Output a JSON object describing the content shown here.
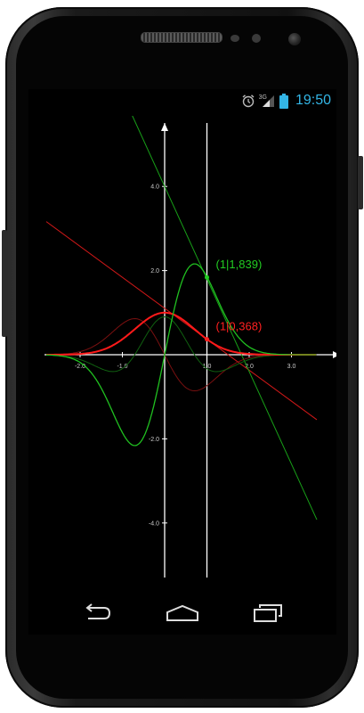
{
  "status_bar": {
    "time": "19:50",
    "network": "3G",
    "icons": [
      "alarm-icon",
      "signal-icon",
      "battery-icon"
    ],
    "accent_color": "#33b5e5"
  },
  "chart_data": {
    "type": "line",
    "xlim": [
      -2.8,
      3.6
    ],
    "ylim": [
      -5.2,
      5.5
    ],
    "x_ticks": [
      "-2.0",
      "-1.0",
      "1.0",
      "2.0",
      "3.0"
    ],
    "y_ticks": [
      "4.0",
      "2.0",
      "-2.0",
      "-4.0"
    ],
    "cursor_x": 1,
    "series": [
      {
        "color": "#ff1a1a",
        "points": [
          [
            -2.8,
            0.0004
          ],
          [
            -2.4,
            0.0032
          ],
          [
            -2.0,
            0.018
          ],
          [
            -1.6,
            0.077
          ],
          [
            -1.2,
            0.237
          ],
          [
            -0.8,
            0.527
          ],
          [
            -0.4,
            0.852
          ],
          [
            0.0,
            1.0
          ],
          [
            0.4,
            0.852
          ],
          [
            0.8,
            0.527
          ],
          [
            1.0,
            0.368
          ],
          [
            1.2,
            0.237
          ],
          [
            1.6,
            0.077
          ],
          [
            2.0,
            0.018
          ],
          [
            2.4,
            0.003
          ],
          [
            2.8,
            0.0004
          ],
          [
            3.6,
            0.0
          ]
        ]
      },
      {
        "color": "#20c020",
        "points": [
          [
            -2.8,
            -0.002
          ],
          [
            -2.4,
            -0.015
          ],
          [
            -2.0,
            -0.073
          ],
          [
            -1.6,
            -0.246
          ],
          [
            -1.2,
            -0.568
          ],
          [
            -0.8,
            -0.843
          ],
          [
            -0.4,
            -0.682
          ],
          [
            0.0,
            0.0
          ],
          [
            0.4,
            0.682
          ],
          [
            0.8,
            0.843
          ],
          [
            1.0,
            0.736
          ],
          [
            1.2,
            0.568
          ],
          [
            1.6,
            0.246
          ],
          [
            2.0,
            0.073
          ],
          [
            2.4,
            0.015
          ],
          [
            2.8,
            0.002
          ],
          [
            3.6,
            0.0
          ]
        ]
      }
    ],
    "points_labels": [
      {
        "text": "(1|0,368)",
        "x": 1,
        "y": 0.368,
        "color": "#ff2020"
      },
      {
        "text": "(1|1,839)",
        "x": 1,
        "y": 1.839,
        "color": "#22cc22"
      }
    ],
    "tangent_lines": [
      {
        "color": "#d01818",
        "slope": -0.736,
        "intercept": 1.104
      },
      {
        "color": "#18a018",
        "slope": -2.2,
        "intercept": 4.0
      }
    ]
  },
  "nav": {
    "back": "back-icon",
    "home": "home-icon",
    "recents": "recents-icon"
  }
}
